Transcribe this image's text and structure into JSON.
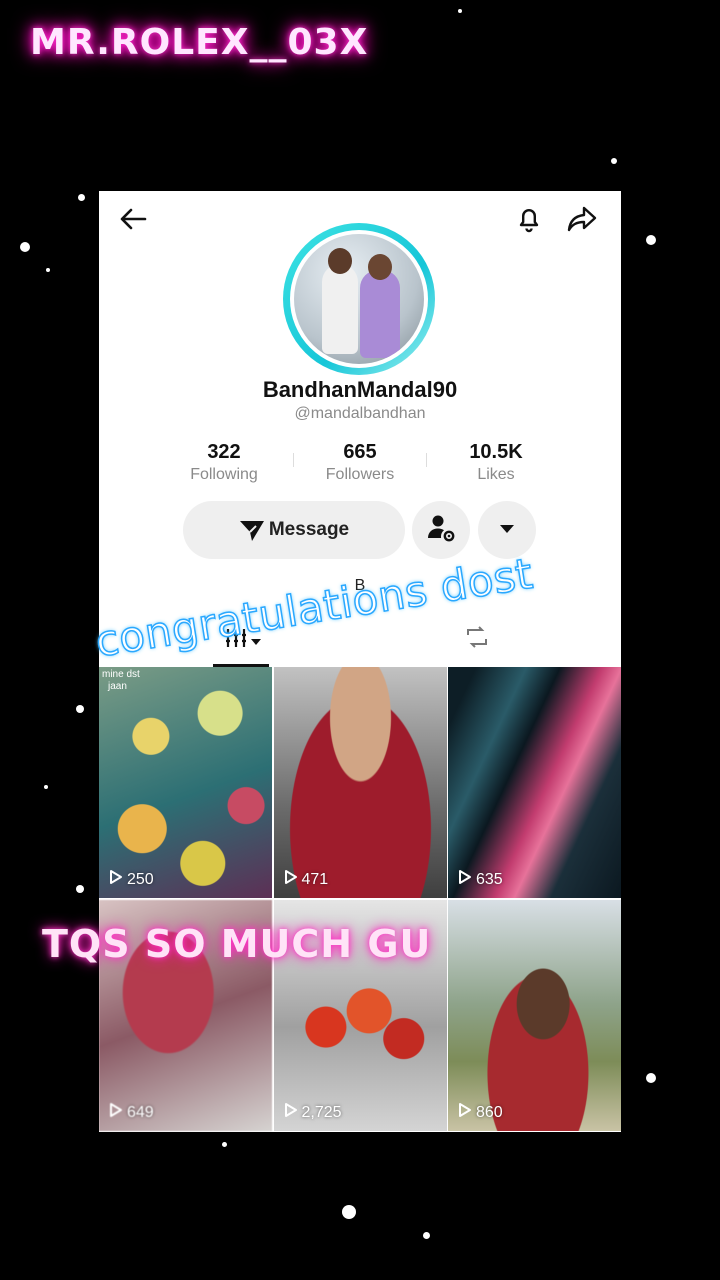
{
  "watermark": "MR.ROLEX__03X",
  "profile": {
    "username": "BandhanMandal90",
    "handle": "@mandalbandhan",
    "stats": [
      {
        "value": "322",
        "label": "Following"
      },
      {
        "value": "665",
        "label": "Followers"
      },
      {
        "value": "10.5K",
        "label": "Likes"
      }
    ],
    "message_label": "Message",
    "bio": "B"
  },
  "videos": [
    {
      "views": "250",
      "caption_lines": [
        "mine dst",
        "jaan"
      ]
    },
    {
      "views": "471"
    },
    {
      "views": "635"
    },
    {
      "views": "649"
    },
    {
      "views": "2,725"
    },
    {
      "views": "860"
    }
  ],
  "overlays": {
    "congrats": "congratulations dost",
    "thanks": "TQS SO MUCH GU"
  },
  "colors": {
    "ring": "#16c6d8",
    "watermark_glow": "#ff00cc",
    "congrats_outline": "#2aa8ff"
  },
  "icons": [
    "back-arrow-icon",
    "bell-icon",
    "share-icon",
    "send-icon",
    "user-settings-icon",
    "caret-down-icon",
    "grid-icon",
    "repost-icon",
    "play-icon"
  ]
}
